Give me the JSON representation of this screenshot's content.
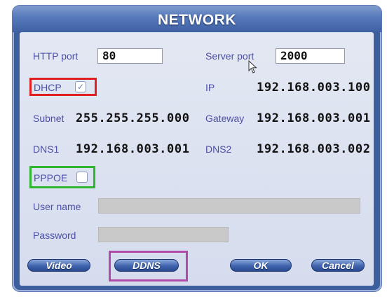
{
  "dialog": {
    "title": "NETWORK"
  },
  "fields": {
    "http_port": {
      "label": "HTTP port",
      "value": "80"
    },
    "server_port": {
      "label": "Server port",
      "value": "2000"
    },
    "dhcp": {
      "label": "DHCP",
      "checked": true
    },
    "ip": {
      "label": "IP",
      "value": "192.168.003.100"
    },
    "subnet": {
      "label": "Subnet",
      "value": "255.255.255.000"
    },
    "gateway": {
      "label": "Gateway",
      "value": "192.168.003.001"
    },
    "dns1": {
      "label": "DNS1",
      "value": "192.168.003.001"
    },
    "dns2": {
      "label": "DNS2",
      "value": "192.168.003.002"
    },
    "pppoe": {
      "label": "PPPOE",
      "checked": false
    },
    "user_name": {
      "label": "User name",
      "value": ""
    },
    "password": {
      "label": "Password",
      "value": ""
    }
  },
  "buttons": {
    "video": "Video",
    "ddns": "DDNS",
    "ok": "OK",
    "cancel": "Cancel"
  },
  "highlights": {
    "dhcp_color": "#e02020",
    "pppoe_color": "#2fb52f",
    "ddns_color": "#b14aa8"
  },
  "icons": {
    "checkmark": "check-icon",
    "cursor": "mouse-pointer-icon"
  }
}
